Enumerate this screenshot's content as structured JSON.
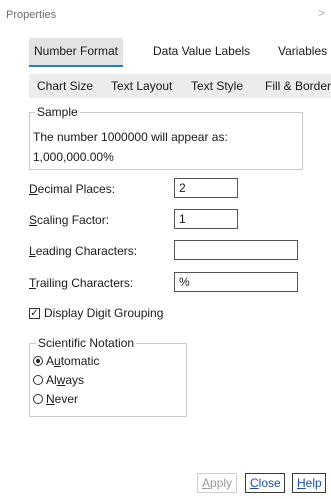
{
  "window": {
    "title": "Properties",
    "close_glyph": ">"
  },
  "tabs_row1": [
    {
      "label": "Number Format",
      "active": true
    },
    {
      "label": "Data Value Labels",
      "active": false
    },
    {
      "label": "Variables",
      "active": false
    }
  ],
  "tabs_row2": [
    {
      "label": "Chart Size"
    },
    {
      "label": "Text Layout"
    },
    {
      "label": "Text Style"
    },
    {
      "label": "Fill & Border"
    }
  ],
  "sample": {
    "legend": "Sample",
    "description": "The number 1000000 will appear as:",
    "value": "1,000,000.00%"
  },
  "fields": {
    "decimal_places": {
      "mnemonic": "D",
      "label_rest": "ecimal Places:",
      "value": "2"
    },
    "scaling_factor": {
      "mnemonic": "S",
      "label_rest": "caling Factor:",
      "value": "1"
    },
    "leading_characters": {
      "mnemonic": "L",
      "label_rest": "eading Characters:",
      "value": ""
    },
    "trailing_characters": {
      "mnemonic": "T",
      "label_rest": "railing Characters:",
      "value": "%"
    }
  },
  "digit_grouping": {
    "label": "Display Digit Grouping",
    "checked": true,
    "check_glyph": "✓"
  },
  "scientific_notation": {
    "legend": "Scientific Notation",
    "options": [
      {
        "pre": "A",
        "mnemonic": "u",
        "post": "tomatic",
        "selected": true
      },
      {
        "pre": "Al",
        "mnemonic": "w",
        "post": "ays",
        "selected": false
      },
      {
        "pre": "",
        "mnemonic": "N",
        "post": "ever",
        "selected": false
      }
    ]
  },
  "buttons": {
    "apply": {
      "pre": "",
      "mnemonic": "A",
      "post": "pply",
      "enabled": false
    },
    "close": {
      "pre": "",
      "mnemonic": "C",
      "post": "lose",
      "enabled": true
    },
    "help": {
      "pre": "",
      "mnemonic": "H",
      "post": "elp",
      "enabled": true
    }
  },
  "colors": {
    "active_tab_underline": "#2a78c8",
    "tab_bg": "#e3e3e3",
    "disabled_text": "#9a9a9a"
  }
}
